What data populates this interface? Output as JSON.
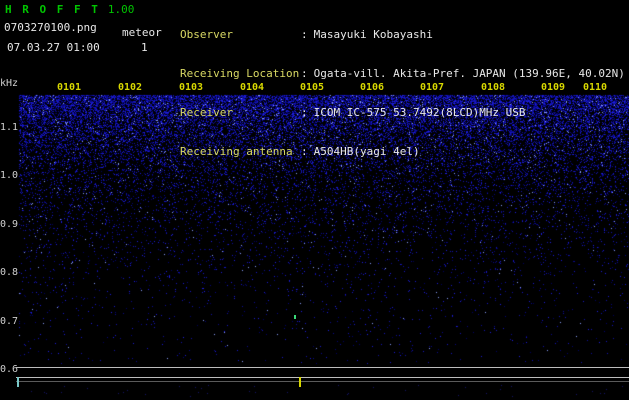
{
  "header": {
    "title": "H R O F F T",
    "version": "1.00",
    "filename": "0703270100.png",
    "mode": "meteor",
    "count": "1",
    "datetime": "07.03.27 01:00"
  },
  "info": {
    "sep": ":",
    "rows": [
      {
        "label": "Observer",
        "value": "Masayuki Kobayashi"
      },
      {
        "label": "Receiving Location",
        "value": "Ogata-vill. Akita-Pref. JAPAN (139.96E, 40.02N)"
      },
      {
        "label": "Receiver",
        "value": "ICOM IC-575 53.7492(8LCD)MHz USB"
      },
      {
        "label": "Receiving antenna",
        "value": "A504HB(yagi 4el)"
      }
    ]
  },
  "chart_data": {
    "type": "heatmap",
    "title": "HROFFT 1.00 radio meteor echo spectrogram, 07.03.27 01:00-01:10",
    "time_ticks": [
      "0101",
      "0102",
      "0103",
      "0104",
      "0105",
      "0106",
      "0107",
      "0108",
      "0109",
      "0110"
    ],
    "time_span": "10 minutes, 1 minute per division",
    "freq_unit": "kHz",
    "freq_ticks": [
      "1.1",
      "1.0",
      "0.9",
      "0.8",
      "0.7",
      "0.6"
    ],
    "freq_range_khz": [
      0.6,
      1.15
    ],
    "noise_profile": "dense blue background noise above ~1.05 kHz fading smoothly to black below ~0.85 kHz",
    "events": [
      {
        "time": "0105",
        "freq_khz": 0.71,
        "type": "meteor echo",
        "color": "green"
      }
    ],
    "signal_strip": {
      "baselines": 3,
      "pulse_time": "0105",
      "pulse_color": "yellow",
      "meteor_count": 1
    },
    "colors": {
      "noise_blue": "#2020c8",
      "title_green": "#00c400",
      "tick_yellow": "#d8d800",
      "axis_white": "#cfcfcf",
      "background": "#000000"
    }
  }
}
